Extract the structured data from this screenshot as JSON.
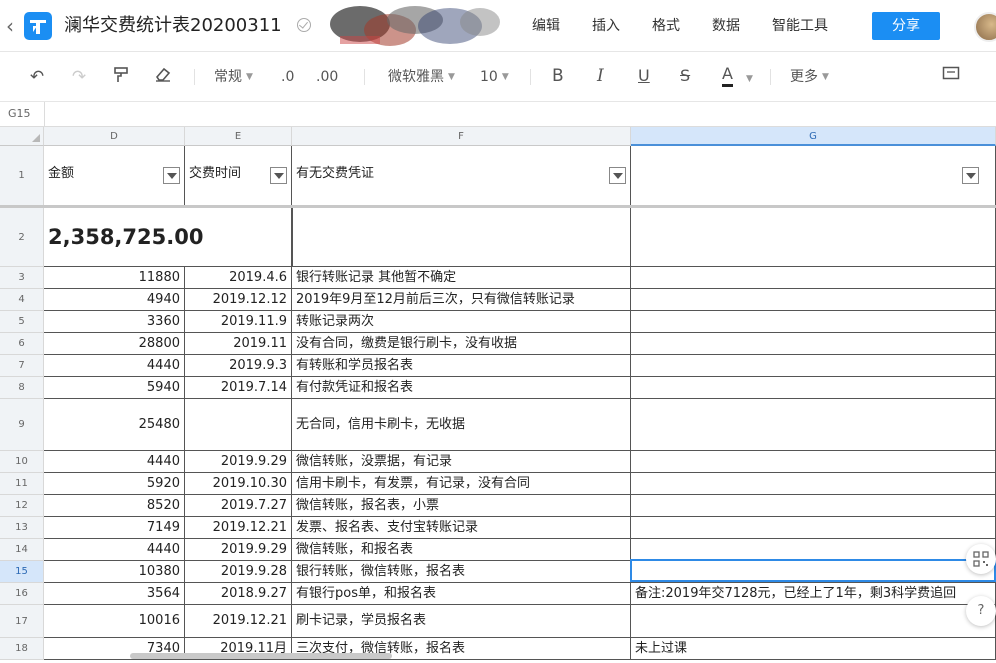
{
  "app": {
    "title": "澜华交费统计表20200311",
    "menu": [
      "编辑",
      "插入",
      "格式",
      "数据",
      "智能工具"
    ],
    "share_label": "分享",
    "accent": "#1b8ef3"
  },
  "toolbar": {
    "number_format": "常规",
    "decrease_decimal": ".0",
    "increase_decimal": ".00",
    "font_name": "微软雅黑",
    "font_size": "10",
    "bold": "B",
    "italic": "I",
    "underline": "U",
    "strike": "S",
    "font_color": "A",
    "more_label": "更多"
  },
  "formula_bar": {
    "cell_ref": "G15"
  },
  "columns": [
    "D",
    "E",
    "F",
    "G"
  ],
  "header_row": {
    "row_num": "1",
    "d": "金额",
    "e": "交费时间",
    "f": "有无交费凭证",
    "g": ""
  },
  "total_row": {
    "row_num": "2",
    "amount": "2,358,725.00"
  },
  "rows": [
    {
      "num": "3",
      "amount": "11880",
      "date": "2019.4.6",
      "proof": "银行转账记录 其他暂不确定",
      "note": ""
    },
    {
      "num": "4",
      "amount": "4940",
      "date": "2019.12.12",
      "proof": "2019年9月至12月前后三次，只有微信转账记录",
      "note": ""
    },
    {
      "num": "5",
      "amount": "3360",
      "date": "2019.11.9",
      "proof": "转账记录两次",
      "note": ""
    },
    {
      "num": "6",
      "amount": "28800",
      "date": "2019.11",
      "proof": "没有合同，缴费是银行刷卡，没有收据",
      "note": ""
    },
    {
      "num": "7",
      "amount": "4440",
      "date": "2019.9.3",
      "proof": "有转账和学员报名表",
      "note": ""
    },
    {
      "num": "8",
      "amount": "5940",
      "date": "2019.7.14",
      "proof": "有付款凭证和报名表",
      "note": ""
    },
    {
      "num": "9",
      "amount": "25480",
      "date": "",
      "proof": "无合同，信用卡刷卡，无收据",
      "note": ""
    },
    {
      "num": "10",
      "amount": "4440",
      "date": "2019.9.29",
      "proof": "微信转账，没票据，有记录",
      "note": ""
    },
    {
      "num": "11",
      "amount": "5920",
      "date": "2019.10.30",
      "proof": "信用卡刷卡，有发票，有记录，没有合同",
      "note": ""
    },
    {
      "num": "12",
      "amount": "8520",
      "date": "2019.7.27",
      "proof": "微信转账，报名表，小票",
      "note": ""
    },
    {
      "num": "13",
      "amount": "7149",
      "date": "2019.12.21",
      "proof": "发票、报名表、支付宝转账记录",
      "note": ""
    },
    {
      "num": "14",
      "amount": "4440",
      "date": "2019.9.29",
      "proof": "微信转账，和报名表",
      "note": ""
    },
    {
      "num": "15",
      "amount": "10380",
      "date": "2019.9.28",
      "proof": "银行转账，微信转账，报名表",
      "note": ""
    },
    {
      "num": "16",
      "amount": "3564",
      "date": "2018.9.27",
      "proof": "有银行pos单，和报名表",
      "note": "备注:2019年交7128元，已经上了1年，剩3科学费追回"
    },
    {
      "num": "17",
      "amount": "10016",
      "date": "2019.12.21",
      "proof": "刷卡记录，学员报名表",
      "note": ""
    },
    {
      "num": "18",
      "amount": "7340",
      "date": "2019.11月",
      "proof": "三次支付，微信转账，报名表",
      "note": "未上过课"
    }
  ],
  "side": {
    "help_label": "?"
  }
}
